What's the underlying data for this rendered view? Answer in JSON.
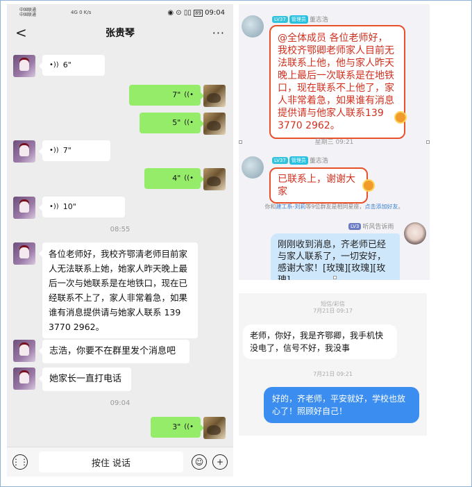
{
  "wechat": {
    "status": {
      "carrier1": "中国联通",
      "carrier2": "中国联通",
      "net": "4G",
      "speed": "0 K/s",
      "right_icons": "◉ ⊙ ▯▯ ",
      "battery": "89",
      "time": "09:04"
    },
    "nav": {
      "back": "<",
      "title": "张贵琴",
      "more": "···"
    },
    "messages": [
      {
        "dir": "left",
        "type": "voice",
        "duration": "6\""
      },
      {
        "dir": "right",
        "type": "voice",
        "duration": "7\""
      },
      {
        "dir": "right",
        "type": "voice",
        "duration": "5\""
      },
      {
        "dir": "left",
        "type": "voice",
        "duration": "7\""
      },
      {
        "dir": "right",
        "type": "voice",
        "duration": "4\""
      },
      {
        "dir": "left",
        "type": "voice",
        "duration": "10\""
      },
      {
        "type": "time",
        "text": "08:55"
      },
      {
        "dir": "left",
        "type": "text",
        "text": "各位老师好，我校齐鄂清老师目前家人无法联系上她，她家人昨天晚上最后一次与她联系是在地铁口，现在已经联系不上了，家人非常着急，如果谁有消息提供请与她家人联系 139 3770 2962。"
      },
      {
        "dir": "left",
        "type": "text",
        "text": "志浩，你要不在群里发个消息吧"
      },
      {
        "dir": "left",
        "type": "text",
        "text": "她家长一直打电话"
      },
      {
        "type": "time",
        "text": "09:04"
      },
      {
        "dir": "right",
        "type": "voice",
        "duration": "3\""
      }
    ],
    "input": {
      "hold_label": "按住 说话",
      "voice_icon": "keyboard-voice-icon",
      "emoji_icon": "emoji-icon",
      "plus_icon": "plus-icon"
    }
  },
  "qq_group": {
    "msg1": {
      "level": "LV37",
      "role": "管理员",
      "name": "董志浩",
      "text": "@全体成员 各位老师好，我校齐鄂卿老师家人目前无法联系上他，他与家人昨天晚上最后一次联系是在地铁口，现在联系不上他了，家人非常着急，如果谁有消息提供请与他家人联系139 3770 2962。"
    },
    "time": "星期三 09:21",
    "msg2": {
      "level": "LV37",
      "role": "管理员",
      "name": "董志浩",
      "text": "已联系上，谢谢大家"
    },
    "sys": {
      "prefix": "你和",
      "name": "建工系-刘莉",
      "middle": "等9位群友是相同星座，",
      "link": "点击添加好友",
      "suffix": "。"
    },
    "msg3": {
      "level": "LV3",
      "name": "听风告诉雨",
      "text": "刚刚收到消息，齐老师已经与家人联系了，一切安好，感谢大家！[玫瑰][玫瑰][玫瑰]"
    }
  },
  "sms": {
    "meta1": "短信/彩信",
    "meta2": "7月21日 09:17",
    "incoming": "老师，你好，我是齐鄂卿，我手机快没电了，信号不好，我没事",
    "meta3": "7月21日 09:21",
    "outgoing": "好的，齐老师，平安就好，学校也放心了！照顾好自己！"
  },
  "colors": {
    "wechat_green": "#95ec69",
    "qq_alert_red": "#d12f1e",
    "sms_blue": "#3b8ef0"
  }
}
